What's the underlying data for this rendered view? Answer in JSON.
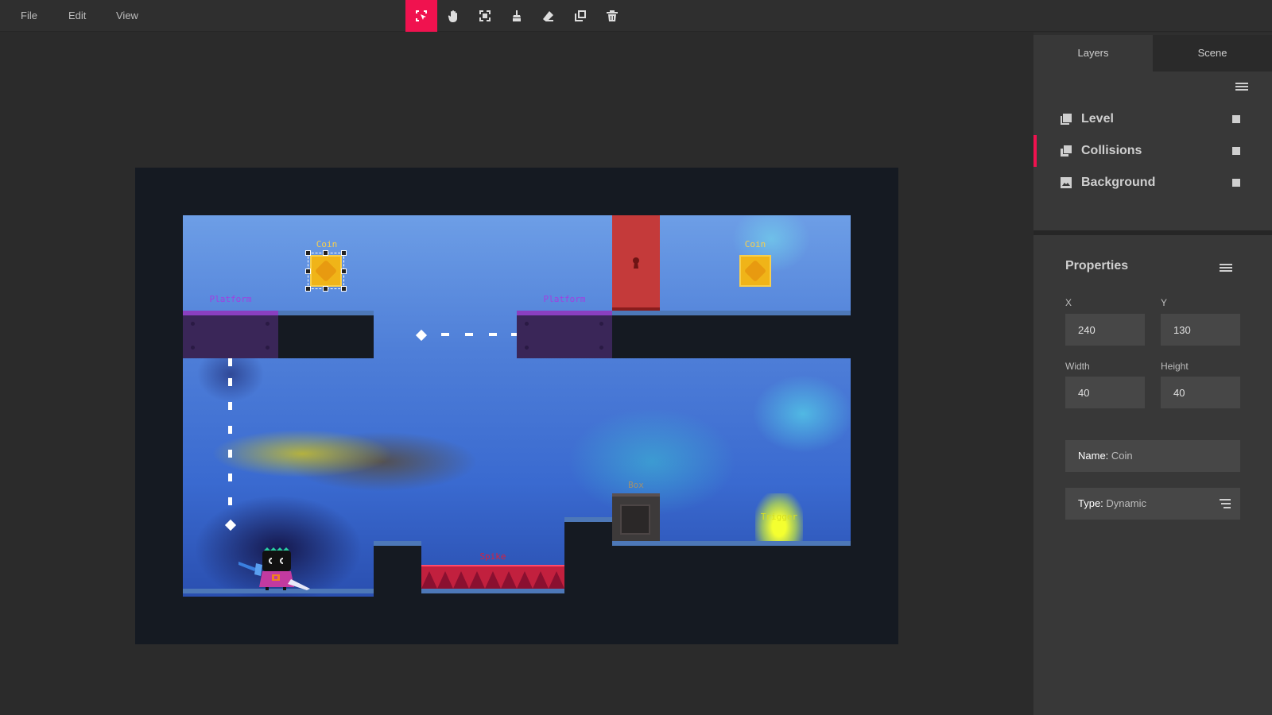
{
  "menu": {
    "file": "File",
    "edit": "Edit",
    "view": "View"
  },
  "toolbar": {
    "tools": [
      "select-tool",
      "pan-tool",
      "fit-tool",
      "brush-tool",
      "eraser-tool",
      "duplicate-tool",
      "delete-tool"
    ],
    "active": "select-tool",
    "accent_color": "#f0124f"
  },
  "level": {
    "labels": {
      "coin_left": "Coin",
      "coin_right": "Coin",
      "platform_left": "Platform",
      "platform_right": "Platform",
      "spike": "Spike",
      "box": "Box",
      "trigger": "Trigger"
    },
    "label_colors": {
      "coin": "#f7cf4d",
      "platform": "#a040e0",
      "spike": "#d8203e",
      "box": "#a09070",
      "trigger": "#d8e020"
    }
  },
  "panel": {
    "tabs": {
      "layers": "Layers",
      "scene": "Scene"
    },
    "layers": [
      {
        "name": "Level",
        "icon": "image-stack-icon"
      },
      {
        "name": "Collisions",
        "icon": "copy-icon",
        "active": true
      },
      {
        "name": "Background",
        "icon": "image-icon"
      }
    ],
    "properties": {
      "title": "Properties",
      "x_label": "X",
      "x_value": "240",
      "y_label": "Y",
      "y_value": "130",
      "width_label": "Width",
      "width_value": "40",
      "height_label": "Height",
      "height_value": "40",
      "name_label": "Name:",
      "name_value": "Coin",
      "type_label": "Type:",
      "type_value": "Dynamic"
    }
  }
}
